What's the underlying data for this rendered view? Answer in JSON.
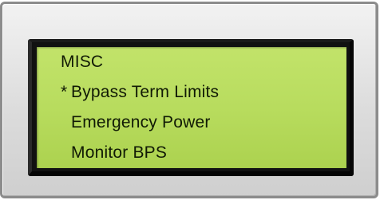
{
  "display": {
    "title": "MISC",
    "cursor_symbol": "*",
    "items": [
      {
        "label": "Bypass Term Limits",
        "selected": true
      },
      {
        "label": "Emergency Power",
        "selected": false
      },
      {
        "label": "Monitor BPS",
        "selected": false
      }
    ]
  },
  "colors": {
    "lcd_background": "#b8dc5e",
    "lcd_text": "#111a05",
    "bezel": "#dcdcdc",
    "screen_frame": "#111111"
  }
}
